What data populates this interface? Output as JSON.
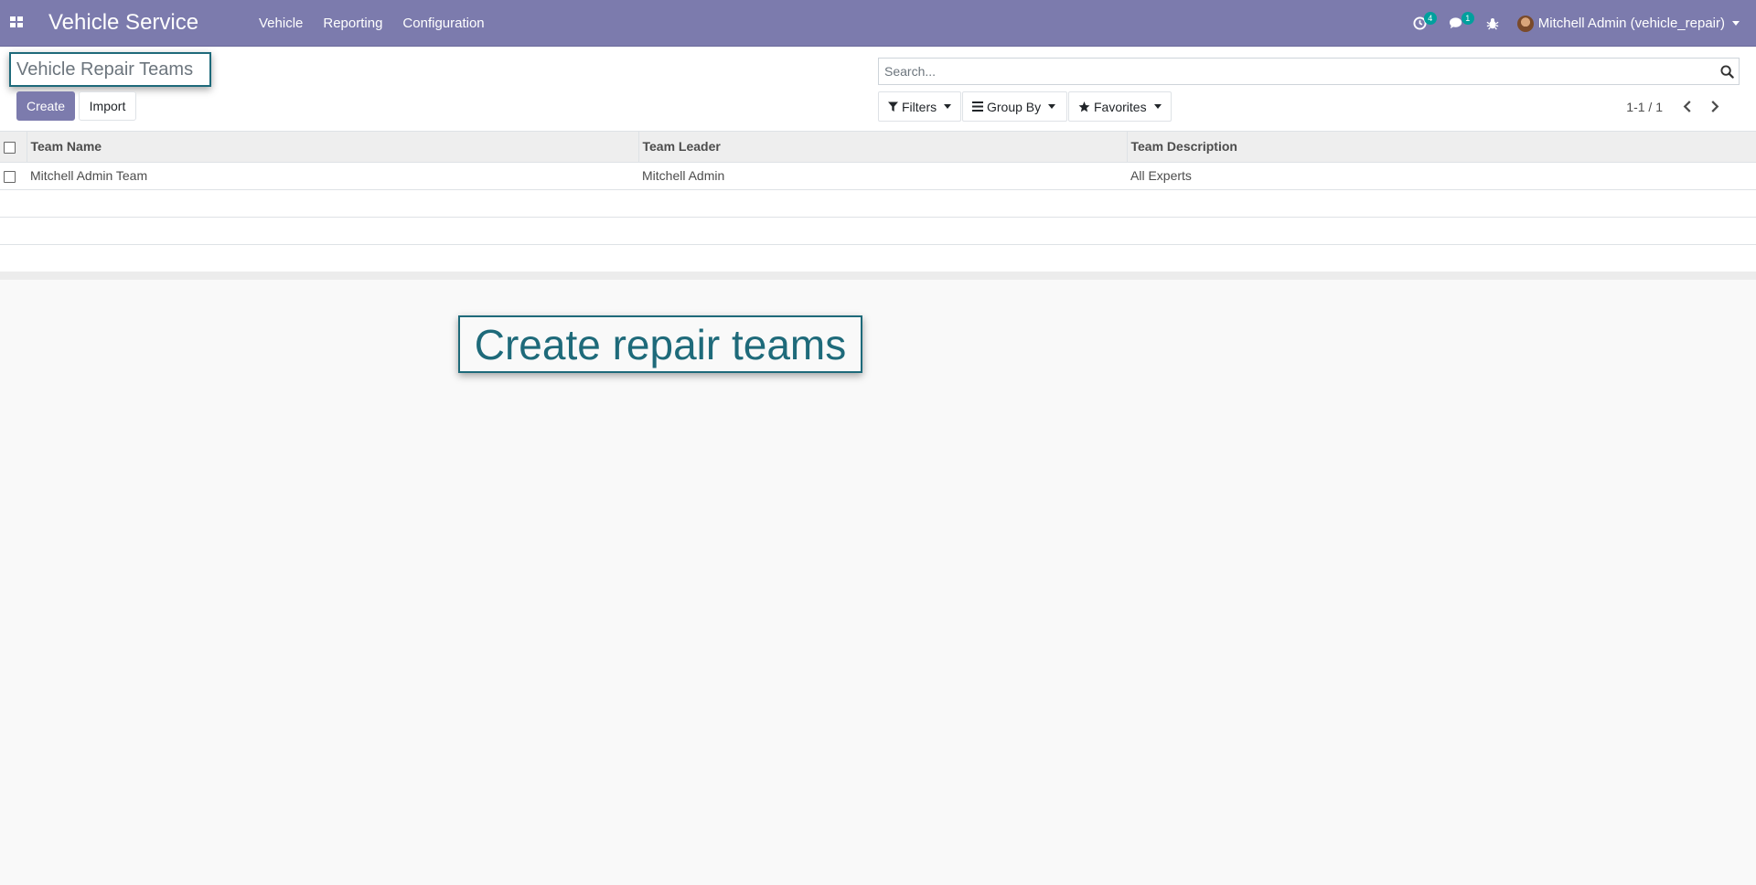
{
  "navbar": {
    "app_title": "Vehicle Service",
    "menu": [
      "Vehicle",
      "Reporting",
      "Configuration"
    ],
    "activity_count": "4",
    "messages_count": "1",
    "user_label": "Mitchell Admin (vehicle_repair)",
    "background_color": "#7c7bad"
  },
  "control_panel": {
    "breadcrumb": "Vehicle Repair Teams",
    "create_label": "Create",
    "import_label": "Import",
    "search_placeholder": "Search...",
    "filters_label": "Filters",
    "groupby_label": "Group By",
    "favorites_label": "Favorites",
    "pager_value": "1-1 / 1"
  },
  "table": {
    "columns": [
      "Team Name",
      "Team Leader",
      "Team Description"
    ],
    "rows": [
      {
        "team_name": "Mitchell Admin Team",
        "team_leader": "Mitchell Admin",
        "team_description": "All Experts"
      }
    ]
  },
  "callout": {
    "text": "Create repair teams",
    "color": "#1e6a7a"
  }
}
